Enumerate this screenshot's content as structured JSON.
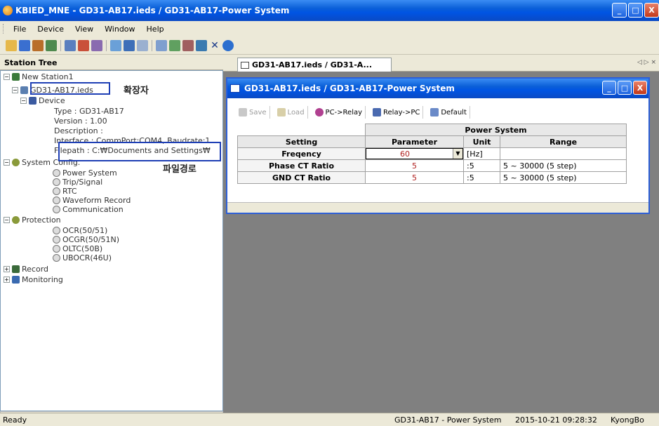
{
  "window": {
    "title": "KBIED_MNE - GD31-AB17.ieds / GD31-AB17-Power System",
    "buttons": {
      "min": "_",
      "max": "□",
      "close": "X"
    }
  },
  "menu": [
    {
      "label": "File",
      "id": "file"
    },
    {
      "label": "Device",
      "id": "device"
    },
    {
      "label": "View",
      "id": "view"
    },
    {
      "label": "Window",
      "id": "window"
    },
    {
      "label": "Help",
      "id": "help"
    }
  ],
  "toolbar_icons": [
    "new-icon",
    "save-icon",
    "open-icon",
    "network-icon",
    "list-icon",
    "connect-icon",
    "settings-icon",
    "link-icon",
    "monitor-icon",
    "grid-icon",
    "window-icon",
    "chart-icon",
    "percent-icon",
    "device-icon",
    "close-x-icon",
    "help-icon"
  ],
  "station_tree": {
    "header": "Station Tree",
    "station": "New Station1",
    "file": "GD31-AB17.ieds",
    "device": "Device",
    "device_props": [
      "Type : GD31-AB17",
      "Version : 1.00",
      "Description :",
      "Interface : CommPort:COM4, Baudrate:1",
      "Filepath : C:₩Documents and Settings₩"
    ],
    "system_config": "System Config.",
    "system_items": [
      "Power System",
      "Trip/Signal",
      "RTC",
      "Waveform Record",
      "Communication"
    ],
    "protection": "Protection",
    "protection_items": [
      "OCR(50/51)",
      "OCGR(50/51N)",
      "OLTC(50B)",
      "UBOCR(46U)"
    ],
    "record": "Record",
    "monitoring": "Monitoring"
  },
  "annotations": {
    "extension": "확장자",
    "filepath": "파일경로"
  },
  "tab": {
    "label": "GD31-AB17.ieds / GD31-A...",
    "nav": "◁ ▷ ×"
  },
  "child_window": {
    "title": "GD31-AB17.ieds / GD31-AB17-Power System",
    "toolbar": {
      "save": "Save",
      "load": "Load",
      "pc_relay": "PC->Relay",
      "relay_pc": "Relay->PC",
      "default": "Default"
    },
    "table": {
      "caption": "Power System",
      "headers": {
        "setting": "Setting",
        "parameter": "Parameter",
        "unit": "Unit",
        "range": "Range"
      },
      "rows": [
        {
          "setting": "Freqency",
          "parameter": "60",
          "unit": "[Hz]",
          "range": ""
        },
        {
          "setting": "Phase CT Ratio",
          "parameter": "5",
          "unit": ":5",
          "range": "5 ~ 30000 (5 step)"
        },
        {
          "setting": "GND CT Ratio",
          "parameter": "5",
          "unit": ":5",
          "range": "5 ~ 30000 (5 step)"
        }
      ]
    }
  },
  "status": {
    "left": "Ready",
    "context": "GD31-AB17 - Power System",
    "datetime": "2015-10-21 09:28:32",
    "user": "KyongBo"
  }
}
